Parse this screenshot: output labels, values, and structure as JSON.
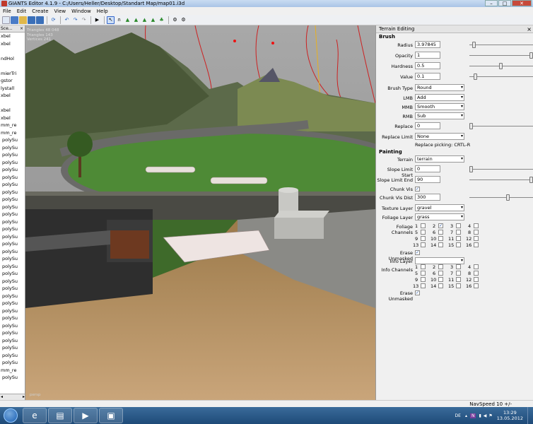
{
  "window": {
    "title": "GIANTS Editor 4.1.9 - C:/Users/Heller/Desktop/Standart Map/map01.i3d",
    "minimize": "–",
    "maximize": "□",
    "close": "✕"
  },
  "menu": [
    "File",
    "Edit",
    "Create",
    "View",
    "Window",
    "Help"
  ],
  "scenegraph": {
    "title": "Sce...",
    "items": [
      "xbel",
      "xbel",
      "",
      "ndHol",
      "",
      "mierTri",
      "gstor",
      "lystall",
      "xbel",
      "",
      "xbel",
      "xbel",
      "mm_re",
      "mm_re",
      "polySu",
      "polySu",
      "polySu",
      "polySu",
      "polySu",
      "polySu",
      "polySu",
      "polySu",
      "polySu",
      "polySu",
      "polySu",
      "polySu",
      "polySu",
      "polySu",
      "polySu",
      "polySu",
      "polySu",
      "polySu",
      "polySu",
      "polySu",
      "polySu",
      "polySu",
      "polySu",
      "polySu",
      "polySu",
      "polySu",
      "polySu",
      "polySu",
      "polySu",
      "polySu",
      "polySu",
      "mm_re",
      "polySu"
    ]
  },
  "viewport": {
    "stats": [
      "Triangles 48 048",
      "Triangles 143",
      "Vertices 241"
    ],
    "camera": "persp"
  },
  "terrain_panel": {
    "title": "Terrain Editing",
    "brush_section": "Brush",
    "radius_label": "Radius",
    "radius": "3.97845",
    "opacity_label": "Opacity",
    "opacity": "1",
    "hardness_label": "Hardness",
    "hardness": "0.5",
    "value_label": "Value",
    "value": "0.1",
    "brush_type_label": "Brush Type",
    "brush_type": "Round",
    "lmb_label": "LMB",
    "lmb": "Add",
    "mmb_label": "MMB",
    "mmb": "Smooth",
    "rmb_label": "RMB",
    "rmb": "Sub",
    "replace_label": "Replace",
    "replace": "0",
    "replace_limit_label": "Replace Limit",
    "replace_limit": "None",
    "replace_picking": "Replace picking: CRTL-R",
    "painting_section": "Painting",
    "terrain_label": "Terrain",
    "terrain": "terrain",
    "slope_start_label": "Slope Limit Start",
    "slope_start": "0",
    "slope_end_label": "Slope Limit End",
    "slope_end": "90",
    "chunk_vis_label": "Chunk Vis",
    "chunk_vis_dist_label": "Chunk Vis Dist",
    "chunk_vis_dist": "300",
    "texture_layer_label": "Texture Layer",
    "texture_layer": "gravel",
    "foliage_layer_label": "Foliage Layer",
    "foliage_layer": "grass",
    "foliage_channels_label": "Foliage Channels",
    "erase_unmasked_label": "Erase Unmasked",
    "info_layer_label": "Info Layer",
    "info_layer": "",
    "info_channels_label": "Info Channels",
    "erase_unmasked2_label": "Erase Unmasked",
    "channel_numbers": [
      "1",
      "2",
      "3",
      "4",
      "5",
      "6",
      "7",
      "8",
      "9",
      "10",
      "11",
      "12",
      "13",
      "14",
      "15",
      "16"
    ]
  },
  "status": {
    "navspeed": "NavSpeed 10 +/-"
  },
  "taskbar": {
    "lang": "DE",
    "time": "13:29",
    "date": "13.05.2012"
  }
}
